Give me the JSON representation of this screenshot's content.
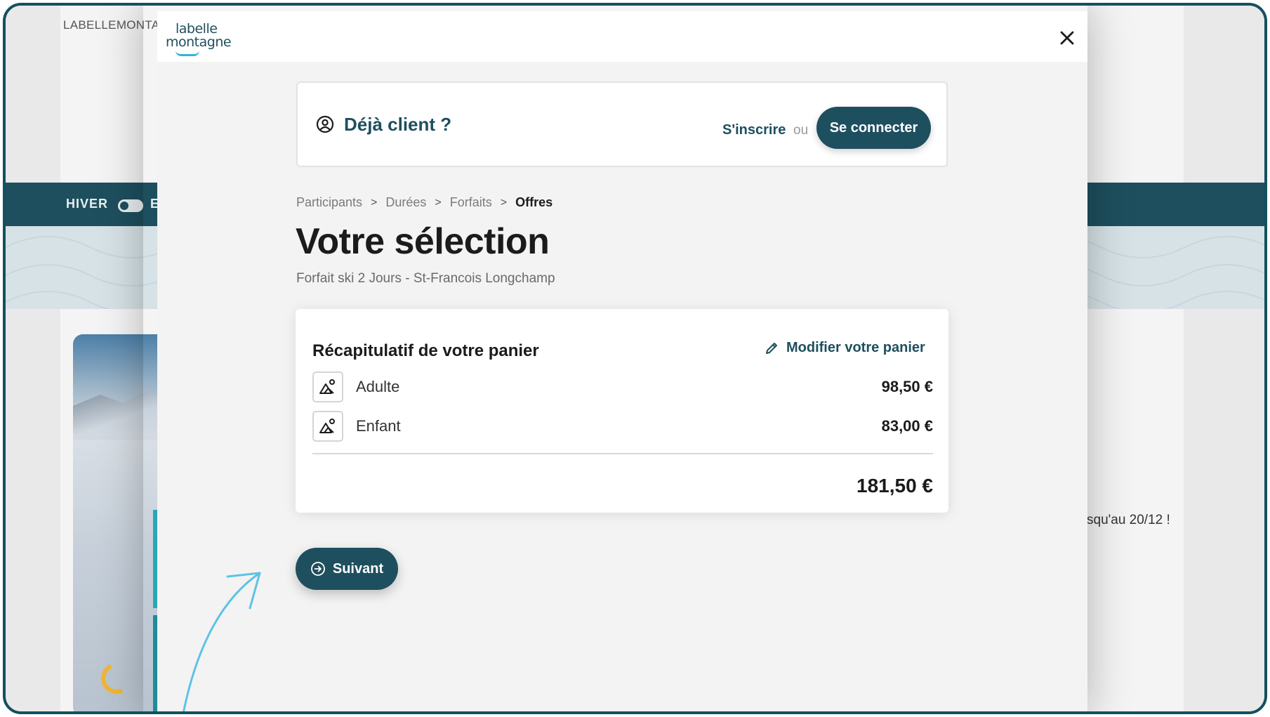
{
  "background": {
    "logo_text": "LABELLEMONTAG",
    "season_label": "HIVER",
    "season_other": "E",
    "promo_text": "squ'au 20/12 !"
  },
  "modal": {
    "brand": {
      "line1": "labelle",
      "line2": "montagne"
    },
    "close_icon": "close-icon",
    "login": {
      "title": "Déjà client ?",
      "icon": "user-circle-icon",
      "signup_label": "S'inscrire",
      "or_label": "ou",
      "connect_label": "Se connecter"
    },
    "breadcrumb": [
      {
        "label": "Participants"
      },
      {
        "label": "Durées"
      },
      {
        "label": "Forfaits"
      },
      {
        "label": "Offres",
        "current": true
      }
    ],
    "title": "Votre sélection",
    "subtitle": "Forfait ski 2 Jours - St-Francois Longchamp",
    "recap": {
      "title": "Récapitulatif de votre panier",
      "edit_label": "Modifier votre panier",
      "items": [
        {
          "label": "Adulte",
          "price": "98,50 €",
          "icon": "mountain-person-icon"
        },
        {
          "label": "Enfant",
          "price": "83,00 €",
          "icon": "mountain-person-icon"
        }
      ],
      "total": "181,50 €"
    },
    "next_label": "Suivant"
  },
  "colors": {
    "brand_dark": "#1e4f5e",
    "brand_light": "#2fb6d3",
    "frame_border": "#14505f",
    "annotation_arrow": "#5cc3e6"
  }
}
